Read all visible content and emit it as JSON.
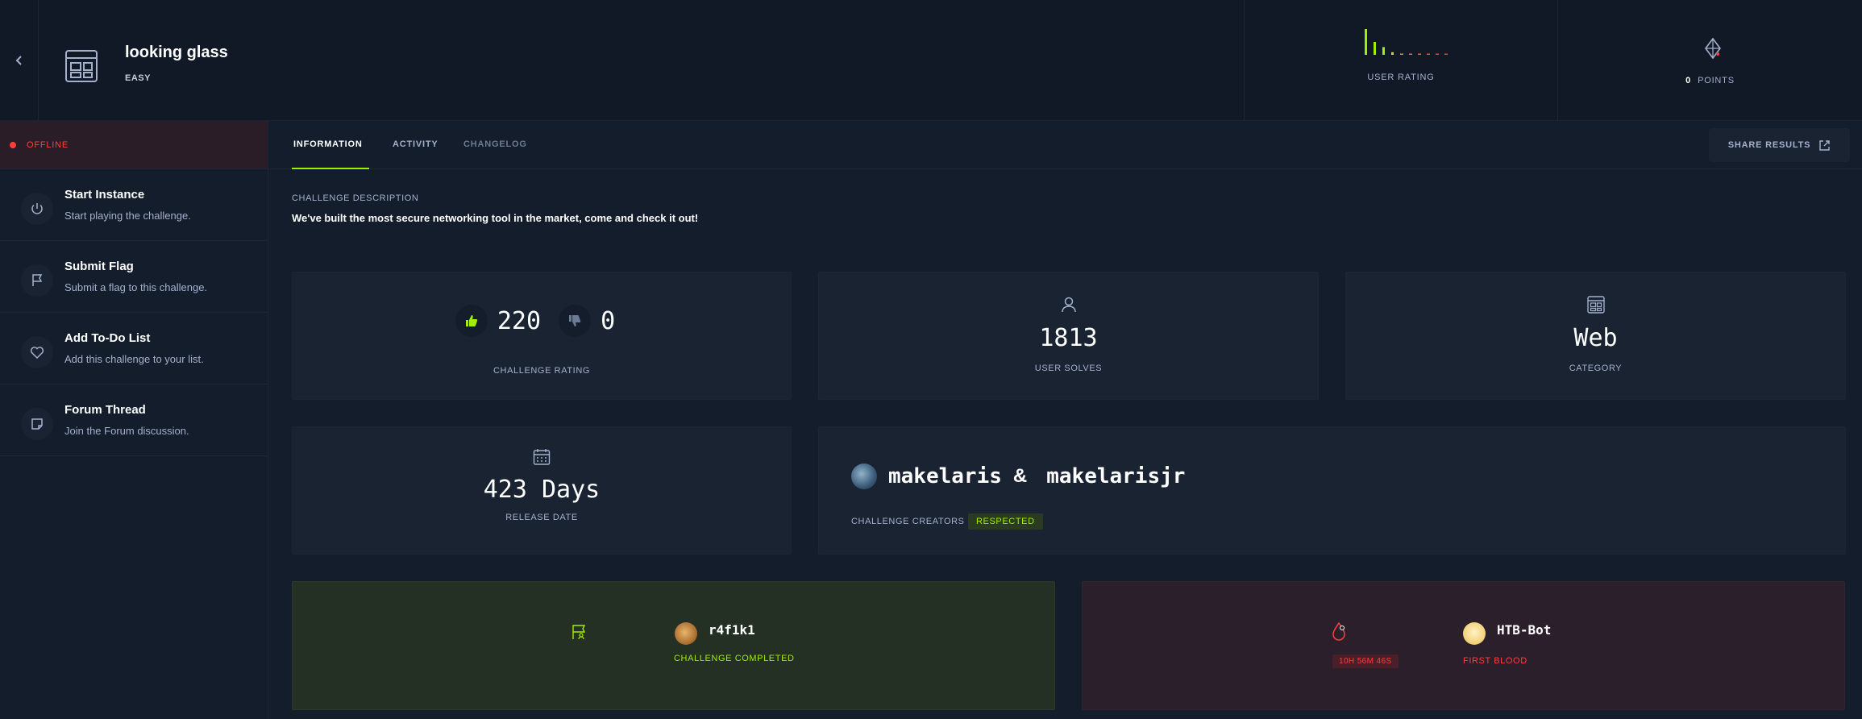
{
  "header": {
    "title": "looking glass",
    "difficulty": "EASY",
    "user_rating_label": "USER RATING",
    "user_rating_distribution": [
      10,
      5,
      3,
      1,
      0,
      0,
      0,
      0,
      0,
      0
    ],
    "points_value": "0",
    "points_label": "POINTS"
  },
  "sidebar": {
    "status": "OFFLINE",
    "actions": [
      {
        "title": "Start Instance",
        "subtitle": "Start playing the challenge.",
        "icon": "power-icon"
      },
      {
        "title": "Submit Flag",
        "subtitle": "Submit a flag to this challenge.",
        "icon": "flag-icon"
      },
      {
        "title": "Add To-Do List",
        "subtitle": "Add this challenge to your list.",
        "icon": "heart-icon"
      },
      {
        "title": "Forum Thread",
        "subtitle": "Join the Forum discussion.",
        "icon": "note-icon"
      }
    ]
  },
  "tabs": [
    {
      "label": "INFORMATION"
    },
    {
      "label": "ACTIVITY"
    },
    {
      "label": "CHANGELOG"
    }
  ],
  "share_label": "SHARE RESULTS",
  "description": {
    "label": "CHALLENGE DESCRIPTION",
    "text": "We've built the most secure networking tool in the market, come and check it out!"
  },
  "stats": {
    "upvotes": "220",
    "downvotes": "0",
    "rating_label": "CHALLENGE RATING",
    "solves": "1813",
    "solves_label": "USER SOLVES",
    "category": "Web",
    "category_label": "CATEGORY",
    "release": "423 Days",
    "release_label": "RELEASE DATE"
  },
  "creators": {
    "names": [
      "makelaris",
      "makelarisjr"
    ],
    "separator": "&",
    "label": "CHALLENGE CREATORS",
    "badge": "RESPECTED"
  },
  "solves_panel": {
    "user": {
      "name": "r4f1k1",
      "status": "CHALLENGE COMPLETED"
    },
    "first_blood": {
      "name": "HTB-Bot",
      "status": "FIRST BLOOD",
      "time": "10H 56M 46S"
    }
  },
  "colors": {
    "accent": "#9fef00",
    "danger": "#ff3e3e",
    "background": "#141d2b",
    "panel": "#1a2332"
  }
}
